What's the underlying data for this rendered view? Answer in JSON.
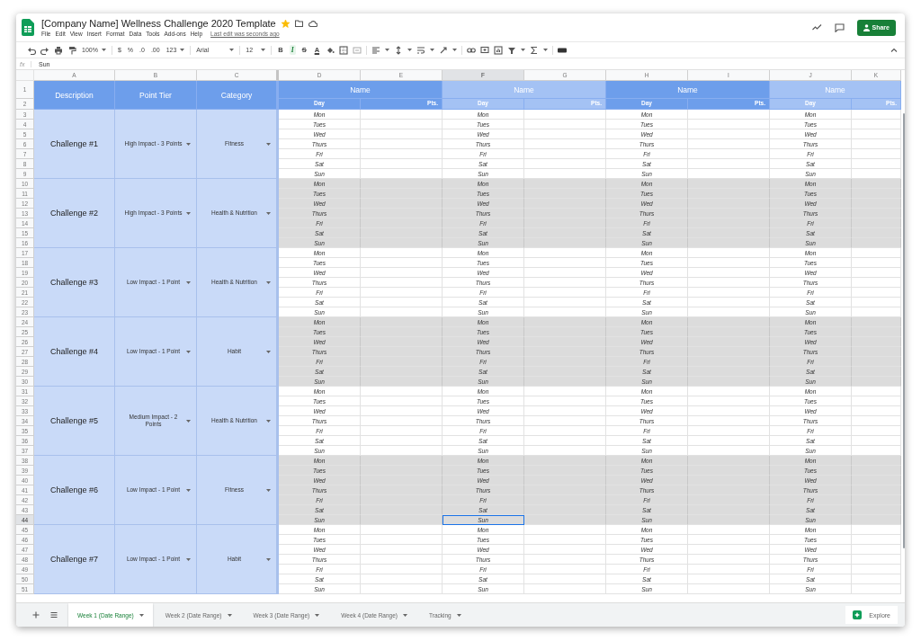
{
  "document": {
    "title": "[Company Name] Wellness Challenge 2020 Template",
    "starred": true,
    "menu": [
      "File",
      "Edit",
      "View",
      "Insert",
      "Format",
      "Data",
      "Tools",
      "Add-ons",
      "Help"
    ],
    "last_edit": "Last edit was seconds ago",
    "share_label": "Share"
  },
  "toolbar": {
    "zoom": "100%",
    "currency": "$",
    "percent": "%",
    "decrease_decimals": ".0",
    "increase_decimals": ".00",
    "number_format": "123",
    "font": "Arial",
    "font_size": "12",
    "formatting": [
      {
        "label": "B",
        "kind": "bold",
        "active": false
      },
      {
        "label": "I",
        "kind": "italic",
        "active": true
      },
      {
        "label": "S",
        "kind": "strike",
        "active": false
      },
      {
        "label": "A",
        "kind": "color",
        "active": false
      }
    ]
  },
  "formula_bar": {
    "label": "fx",
    "value": "Sun"
  },
  "columns": [
    "A",
    "B",
    "C",
    "D",
    "E",
    "F",
    "G",
    "H",
    "I",
    "J",
    "K"
  ],
  "header": {
    "row_numbers": [
      "1",
      "2"
    ],
    "description": "Description",
    "point_tier": "Point Tier",
    "category": "Category"
  },
  "participants": [
    {
      "name": "Name",
      "day_label": "Day",
      "points_label": "Pts.",
      "color": "#6d9eeb"
    },
    {
      "name": "Name",
      "day_label": "Day",
      "points_label": "Pts.",
      "color": "#a4c2f4"
    },
    {
      "name": "Name",
      "day_label": "Day",
      "points_label": "Pts.",
      "color": "#6d9eeb"
    },
    {
      "name": "Name",
      "day_label": "Day",
      "points_label": "Pts.",
      "color": "#a4c2f4"
    }
  ],
  "challenges": [
    {
      "description": "Challenge #1",
      "point_tier": "High Impact - 3 Points",
      "category": "Fitness",
      "shaded": false,
      "rows": [
        {
          "number": "3",
          "days": [
            "Mon",
            "Mon",
            "Mon",
            "Mon"
          ],
          "selected": [
            false,
            false,
            false,
            false
          ]
        },
        {
          "number": "4",
          "days": [
            "Tues",
            "Tues",
            "Tues",
            "Tues"
          ],
          "selected": [
            false,
            false,
            false,
            false
          ]
        },
        {
          "number": "5",
          "days": [
            "Wed",
            "Wed",
            "Wed",
            "Wed"
          ],
          "selected": [
            false,
            false,
            false,
            false
          ]
        },
        {
          "number": "6",
          "days": [
            "Thurs",
            "Thurs",
            "Thurs",
            "Thurs"
          ],
          "selected": [
            false,
            false,
            false,
            false
          ]
        },
        {
          "number": "7",
          "days": [
            "Fri",
            "Fri",
            "Fri",
            "Fri"
          ],
          "selected": [
            false,
            false,
            false,
            false
          ]
        },
        {
          "number": "8",
          "days": [
            "Sat",
            "Sat",
            "Sat",
            "Sat"
          ],
          "selected": [
            false,
            false,
            false,
            false
          ]
        },
        {
          "number": "9",
          "days": [
            "Sun",
            "Sun",
            "Sun",
            "Sun"
          ],
          "selected": [
            false,
            false,
            false,
            false
          ]
        }
      ]
    },
    {
      "description": "Challenge #2",
      "point_tier": "High Impact - 3 Points",
      "category": "Health & Nutrition",
      "shaded": true,
      "rows": [
        {
          "number": "10",
          "days": [
            "Mon",
            "Mon",
            "Mon",
            "Mon"
          ],
          "selected": [
            false,
            false,
            false,
            false
          ]
        },
        {
          "number": "11",
          "days": [
            "Tues",
            "Tues",
            "Tues",
            "Tues"
          ],
          "selected": [
            false,
            false,
            false,
            false
          ]
        },
        {
          "number": "12",
          "days": [
            "Wed",
            "Wed",
            "Wed",
            "Wed"
          ],
          "selected": [
            false,
            false,
            false,
            false
          ]
        },
        {
          "number": "13",
          "days": [
            "Thurs",
            "Thurs",
            "Thurs",
            "Thurs"
          ],
          "selected": [
            false,
            false,
            false,
            false
          ]
        },
        {
          "number": "14",
          "days": [
            "Fri",
            "Fri",
            "Fri",
            "Fri"
          ],
          "selected": [
            false,
            false,
            false,
            false
          ]
        },
        {
          "number": "15",
          "days": [
            "Sat",
            "Sat",
            "Sat",
            "Sat"
          ],
          "selected": [
            false,
            false,
            false,
            false
          ]
        },
        {
          "number": "16",
          "days": [
            "Sun",
            "Sun",
            "Sun",
            "Sun"
          ],
          "selected": [
            false,
            false,
            false,
            false
          ]
        }
      ]
    },
    {
      "description": "Challenge #3",
      "point_tier": "Low Impact - 1 Point",
      "category": "Health & Nutrition",
      "shaded": false,
      "rows": [
        {
          "number": "17",
          "days": [
            "Mon",
            "Mon",
            "Mon",
            "Mon"
          ],
          "selected": [
            false,
            false,
            false,
            false
          ]
        },
        {
          "number": "18",
          "days": [
            "Tues",
            "Tues",
            "Tues",
            "Tues"
          ],
          "selected": [
            false,
            false,
            false,
            false
          ]
        },
        {
          "number": "19",
          "days": [
            "Wed",
            "Wed",
            "Wed",
            "Wed"
          ],
          "selected": [
            false,
            false,
            false,
            false
          ]
        },
        {
          "number": "20",
          "days": [
            "Thurs",
            "Thurs",
            "Thurs",
            "Thurs"
          ],
          "selected": [
            false,
            false,
            false,
            false
          ]
        },
        {
          "number": "21",
          "days": [
            "Fri",
            "Fri",
            "Fri",
            "Fri"
          ],
          "selected": [
            false,
            false,
            false,
            false
          ]
        },
        {
          "number": "22",
          "days": [
            "Sat",
            "Sat",
            "Sat",
            "Sat"
          ],
          "selected": [
            false,
            false,
            false,
            false
          ]
        },
        {
          "number": "23",
          "days": [
            "Sun",
            "Sun",
            "Sun",
            "Sun"
          ],
          "selected": [
            false,
            false,
            false,
            false
          ]
        }
      ]
    },
    {
      "description": "Challenge #4",
      "point_tier": "Low Impact - 1 Point",
      "category": "Habit",
      "shaded": true,
      "rows": [
        {
          "number": "24",
          "days": [
            "Mon",
            "Mon",
            "Mon",
            "Mon"
          ],
          "selected": [
            false,
            false,
            false,
            false
          ]
        },
        {
          "number": "25",
          "days": [
            "Tues",
            "Tues",
            "Tues",
            "Tues"
          ],
          "selected": [
            false,
            false,
            false,
            false
          ]
        },
        {
          "number": "26",
          "days": [
            "Wed",
            "Wed",
            "Wed",
            "Wed"
          ],
          "selected": [
            false,
            false,
            false,
            false
          ]
        },
        {
          "number": "27",
          "days": [
            "Thurs",
            "Thurs",
            "Thurs",
            "Thurs"
          ],
          "selected": [
            false,
            false,
            false,
            false
          ]
        },
        {
          "number": "28",
          "days": [
            "Fri",
            "Fri",
            "Fri",
            "Fri"
          ],
          "selected": [
            false,
            false,
            false,
            false
          ]
        },
        {
          "number": "29",
          "days": [
            "Sat",
            "Sat",
            "Sat",
            "Sat"
          ],
          "selected": [
            false,
            false,
            false,
            false
          ]
        },
        {
          "number": "30",
          "days": [
            "Sun",
            "Sun",
            "Sun",
            "Sun"
          ],
          "selected": [
            false,
            false,
            false,
            false
          ]
        }
      ]
    },
    {
      "description": "Challenge #5",
      "point_tier": "Medium Impact - 2 Points",
      "category": "Health & Nutrition",
      "shaded": false,
      "rows": [
        {
          "number": "31",
          "days": [
            "Mon",
            "Mon",
            "Mon",
            "Mon"
          ],
          "selected": [
            false,
            false,
            false,
            false
          ]
        },
        {
          "number": "32",
          "days": [
            "Tues",
            "Tues",
            "Tues",
            "Tues"
          ],
          "selected": [
            false,
            false,
            false,
            false
          ]
        },
        {
          "number": "33",
          "days": [
            "Wed",
            "Wed",
            "Wed",
            "Wed"
          ],
          "selected": [
            false,
            false,
            false,
            false
          ]
        },
        {
          "number": "34",
          "days": [
            "Thurs",
            "Thurs",
            "Thurs",
            "Thurs"
          ],
          "selected": [
            false,
            false,
            false,
            false
          ]
        },
        {
          "number": "35",
          "days": [
            "Fri",
            "Fri",
            "Fri",
            "Fri"
          ],
          "selected": [
            false,
            false,
            false,
            false
          ]
        },
        {
          "number": "36",
          "days": [
            "Sat",
            "Sat",
            "Sat",
            "Sat"
          ],
          "selected": [
            false,
            false,
            false,
            false
          ]
        },
        {
          "number": "37",
          "days": [
            "Sun",
            "Sun",
            "Sun",
            "Sun"
          ],
          "selected": [
            false,
            false,
            false,
            false
          ]
        }
      ]
    },
    {
      "description": "Challenge #6",
      "point_tier": "Low Impact - 1 Point",
      "category": "Fitness",
      "shaded": true,
      "rows": [
        {
          "number": "38",
          "days": [
            "Mon",
            "Mon",
            "Mon",
            "Mon"
          ],
          "selected": [
            false,
            false,
            false,
            false
          ]
        },
        {
          "number": "39",
          "days": [
            "Tues",
            "Tues",
            "Tues",
            "Tues"
          ],
          "selected": [
            false,
            false,
            false,
            false
          ]
        },
        {
          "number": "40",
          "days": [
            "Wed",
            "Wed",
            "Wed",
            "Wed"
          ],
          "selected": [
            false,
            false,
            false,
            false
          ]
        },
        {
          "number": "41",
          "days": [
            "Thurs",
            "Thurs",
            "Thurs",
            "Thurs"
          ],
          "selected": [
            false,
            false,
            false,
            false
          ]
        },
        {
          "number": "42",
          "days": [
            "Fri",
            "Fri",
            "Fri",
            "Fri"
          ],
          "selected": [
            false,
            false,
            false,
            false
          ]
        },
        {
          "number": "43",
          "days": [
            "Sat",
            "Sat",
            "Sat",
            "Sat"
          ],
          "selected": [
            false,
            false,
            false,
            false
          ]
        },
        {
          "number": "44",
          "days": [
            "Sun",
            "Sun",
            "Sun",
            "Sun"
          ],
          "selected": [
            false,
            true,
            false,
            false
          ]
        }
      ]
    },
    {
      "description": "Challenge #7",
      "point_tier": "Low Impact - 1 Point",
      "category": "Habit",
      "shaded": false,
      "rows": [
        {
          "number": "45",
          "days": [
            "Mon",
            "Mon",
            "Mon",
            "Mon"
          ],
          "selected": [
            false,
            false,
            false,
            false
          ]
        },
        {
          "number": "46",
          "days": [
            "Tues",
            "Tues",
            "Tues",
            "Tues"
          ],
          "selected": [
            false,
            false,
            false,
            false
          ]
        },
        {
          "number": "47",
          "days": [
            "Wed",
            "Wed",
            "Wed",
            "Wed"
          ],
          "selected": [
            false,
            false,
            false,
            false
          ]
        },
        {
          "number": "48",
          "days": [
            "Thurs",
            "Thurs",
            "Thurs",
            "Thurs"
          ],
          "selected": [
            false,
            false,
            false,
            false
          ]
        },
        {
          "number": "49",
          "days": [
            "Fri",
            "Fri",
            "Fri",
            "Fri"
          ],
          "selected": [
            false,
            false,
            false,
            false
          ]
        },
        {
          "number": "50",
          "days": [
            "Sat",
            "Sat",
            "Sat",
            "Sat"
          ],
          "selected": [
            false,
            false,
            false,
            false
          ]
        },
        {
          "number": "51",
          "days": [
            "Sun",
            "Sun",
            "Sun",
            "Sun"
          ],
          "selected": [
            false,
            false,
            false,
            false
          ]
        }
      ]
    }
  ],
  "sheet_tabs": [
    {
      "label": "Week 1 (Date Range)",
      "selected": true
    },
    {
      "label": "Week 2 (Date Range)",
      "selected": false
    },
    {
      "label": "Week 3 (Date Range)",
      "selected": false
    },
    {
      "label": "Week 4 (Date Range)",
      "selected": false
    },
    {
      "label": "Tracking",
      "selected": false
    }
  ],
  "explore_label": "Explore"
}
